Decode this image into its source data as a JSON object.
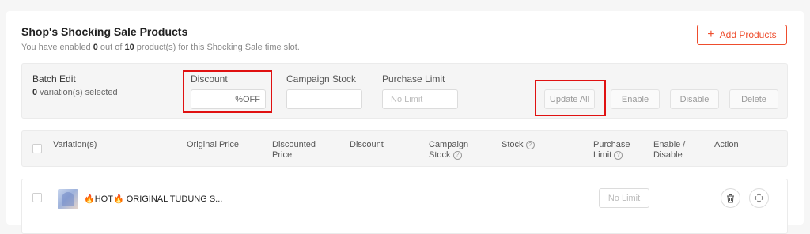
{
  "header": {
    "title": "Shop's Shocking Sale Products",
    "subtitle_pre": "You have enabled ",
    "enabled_count": "0",
    "subtitle_mid": " out of ",
    "total_count": "10",
    "subtitle_post": " product(s) for this Shocking Sale time slot.",
    "add_button": "Add Products"
  },
  "batch": {
    "title": "Batch Edit",
    "selected_count": "0",
    "selected_suffix": " variation(s) selected",
    "discount_label": "Discount",
    "discount_value": "",
    "discount_suffix": "%OFF",
    "stock_label": "Campaign Stock",
    "stock_value": "",
    "limit_label": "Purchase Limit",
    "limit_placeholder": "No Limit",
    "update_all": "Update All",
    "enable": "Enable",
    "disable": "Disable",
    "delete": "Delete"
  },
  "table": {
    "columns": {
      "variation": "Variation(s)",
      "original_price": "Original Price",
      "discounted_price_1": "Discounted",
      "discounted_price_2": "Price",
      "discount": "Discount",
      "campaign_stock_1": "Campaign",
      "campaign_stock_2": "Stock",
      "stock": "Stock",
      "purchase_limit_1": "Purchase",
      "purchase_limit_2": "Limit",
      "enable_disable_1": "Enable /",
      "enable_disable_2": "Disable",
      "action": "Action"
    },
    "rows": [
      {
        "name": "HOT",
        "name_rest": " ORIGINAL TUDUNG S...",
        "purchase_limit": "No Limit"
      }
    ]
  },
  "colors": {
    "accent": "#ee4d2d",
    "highlight": "#e01111"
  }
}
